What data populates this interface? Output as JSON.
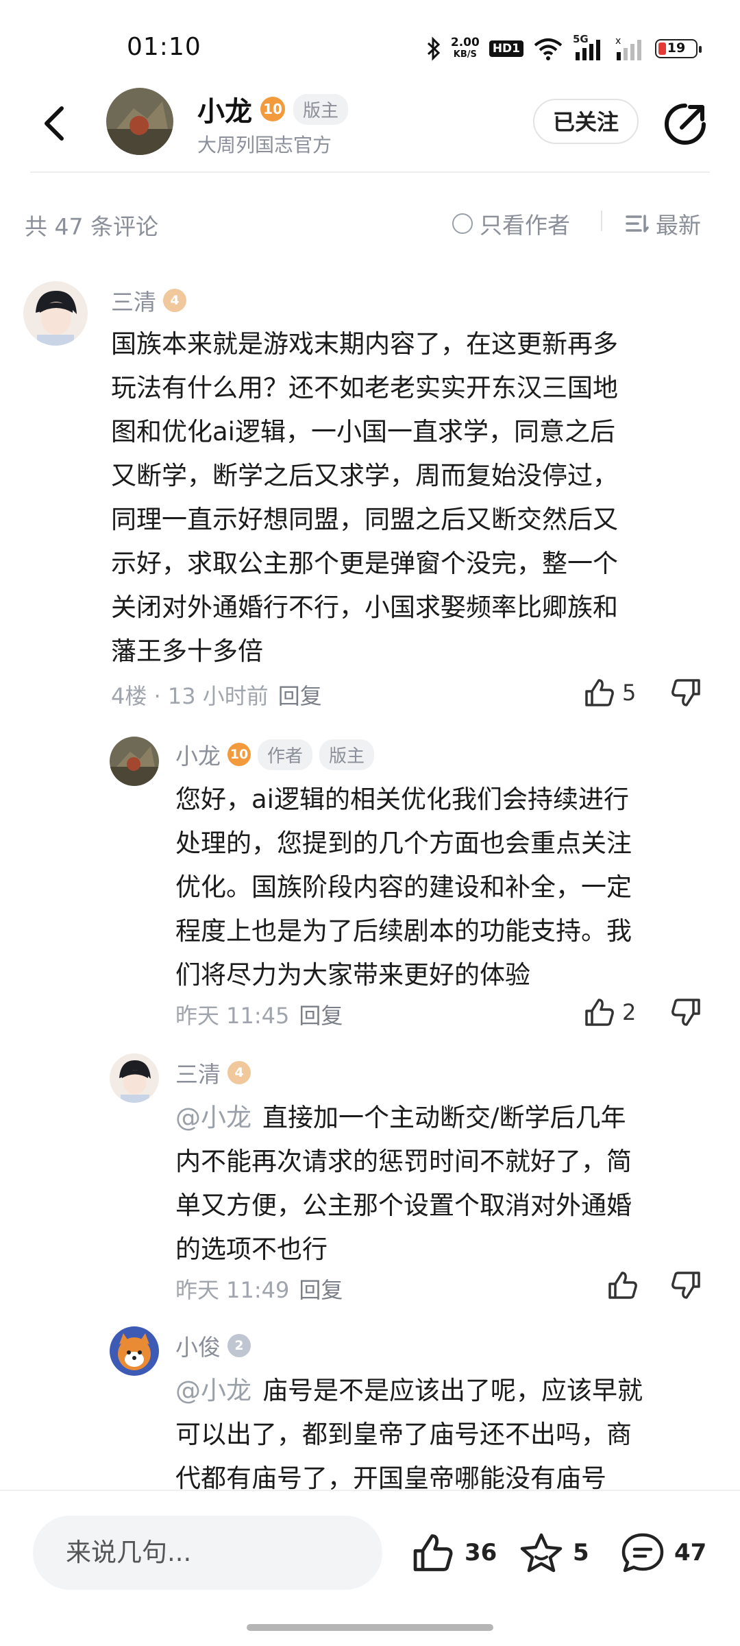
{
  "status_bar": {
    "time": "01:10",
    "net_speed_value": "2.00",
    "net_speed_unit": "KB/S",
    "hd_label": "HD1",
    "network_label": "5G",
    "battery": "19"
  },
  "header": {
    "name": "小龙",
    "level": "10",
    "tag": "版主",
    "subtitle": "大周列国志官方",
    "follow_label": "已关注"
  },
  "filter": {
    "count_label": "共 47 条评论",
    "author_only_label": "只看作者",
    "sort_label": "最新"
  },
  "comments": [
    {
      "user": "三清",
      "level": "4",
      "lines": [
        "国族本来就是游戏末期内容了，在这更新再多",
        "玩法有什么用？还不如老老实实开东汉三国地",
        "图和优化ai逻辑，一小国一直求学，同意之后",
        "又断学，断学之后又求学，周而复始没停过，",
        "同理一直示好想同盟，同盟之后又断交然后又",
        "示好，求取公主那个更是弹窗个没完，整一个",
        "关闭对外通婚行不行，小国求娶频率比卿族和",
        "藩王多十多倍"
      ],
      "meta": "4楼 · 13 小时前",
      "reply_label": "回复",
      "likes": "5"
    },
    {
      "user": "小龙",
      "level": "10",
      "tags": [
        "作者",
        "版主"
      ],
      "lines": [
        "您好，ai逻辑的相关优化我们会持续进行",
        "处理的，您提到的几个方面也会重点关注",
        "优化。国族阶段内容的建设和补全，一定",
        "程度上也是为了后续剧本的功能支持。我",
        "们将尽力为大家带来更好的体验"
      ],
      "meta": "昨天 11:45",
      "reply_label": "回复",
      "likes": "2"
    },
    {
      "user": "三清",
      "level": "4",
      "mention": "@小龙",
      "lines": [
        "直接加一个主动断交/断学后几年",
        "内不能再次请求的惩罚时间不就好了，简",
        "单又方便，公主那个设置个取消对外通婚",
        "的选项不也行"
      ],
      "meta": "昨天 11:49",
      "reply_label": "回复",
      "likes": ""
    },
    {
      "user": "小俊",
      "level": "2",
      "mention": "@小龙",
      "lines": [
        "庙号是不是应该出了呢，应该早就",
        "可以出了，都到皇帝了庙号还不出吗，商",
        "代都有庙号了，开国皇帝哪能没有庙号"
      ]
    }
  ],
  "bottom_bar": {
    "input_placeholder": "来说几句...",
    "likes": "36",
    "favorites": "5",
    "comments": "47"
  }
}
